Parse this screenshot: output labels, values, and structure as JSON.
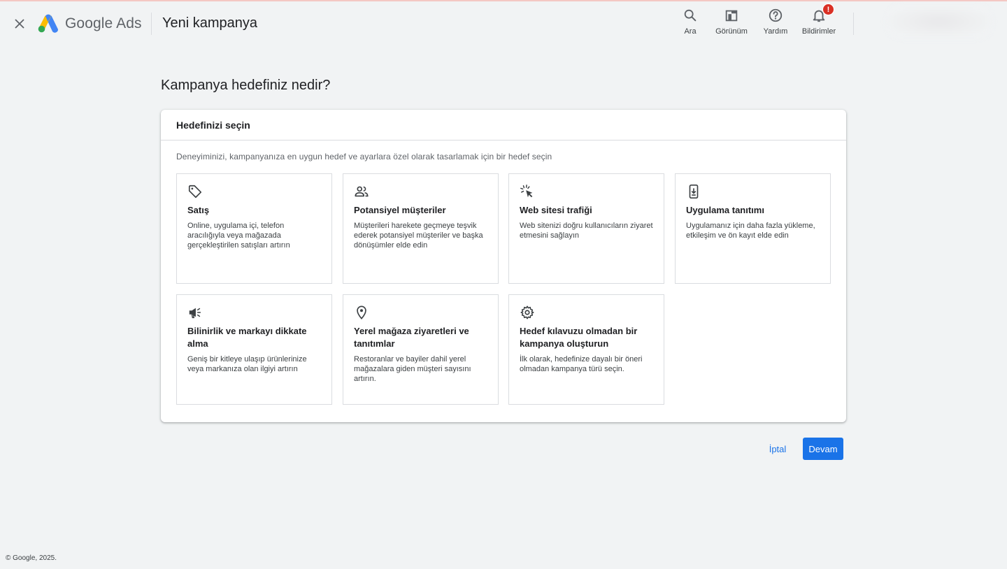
{
  "header": {
    "brand": "Google Ads",
    "title": "Yeni kampanya",
    "tools": [
      {
        "label": "Ara",
        "icon": "search-icon"
      },
      {
        "label": "Görünüm",
        "icon": "appearance-icon"
      },
      {
        "label": "Yardım",
        "icon": "help-icon"
      },
      {
        "label": "Bildirimler",
        "icon": "bell-icon",
        "badge": "!"
      }
    ]
  },
  "main": {
    "question": "Kampanya hedefiniz nedir?",
    "card_title": "Hedefinizi seçin",
    "card_description": "Deneyiminizi, kampanyanıza en uygun hedef ve ayarlara özel olarak tasarlamak için bir hedef seçin",
    "goals": [
      {
        "title": "Satış",
        "text": "Online, uygulama içi, telefon aracılığıyla veya mağazada gerçekleştirilen satışları artırın",
        "icon": "tag-icon"
      },
      {
        "title": "Potansiyel müşteriler",
        "text": "Müşterileri harekete geçmeye teşvik ederek potansiyel müşteriler ve başka dönüşümler elde edin",
        "icon": "people-icon"
      },
      {
        "title": "Web sitesi trafiği",
        "text": "Web sitenizi doğru kullanıcıların ziyaret etmesini sağlayın",
        "icon": "cursor-click-icon"
      },
      {
        "title": "Uygulama tanıtımı",
        "text": "Uygulamanız için daha fazla yükleme, etkileşim ve ön kayıt elde edin",
        "icon": "phone-download-icon"
      },
      {
        "title": "Bilinirlik ve markayı dikkate alma",
        "text": "Geniş bir kitleye ulaşıp ürünlerinize veya markanıza olan ilgiyi artırın",
        "icon": "megaphone-icon"
      },
      {
        "title": "Yerel mağaza ziyaretleri ve tanıtımlar",
        "text": "Restoranlar ve bayiler dahil yerel mağazalara giden müşteri sayısını artırın.",
        "icon": "location-pin-icon"
      },
      {
        "title": "Hedef kılavuzu olmadan bir kampanya oluşturun",
        "text": "İlk olarak, hedefinize dayalı bir öneri olmadan kampanya türü seçin.",
        "icon": "gear-icon"
      }
    ]
  },
  "actions": {
    "cancel": "İptal",
    "continue": "Devam"
  },
  "footer": {
    "copyright": "© Google, 2025."
  },
  "colors": {
    "primary": "#1a73e8",
    "background": "#f1f3f4",
    "badge": "#d93025"
  }
}
